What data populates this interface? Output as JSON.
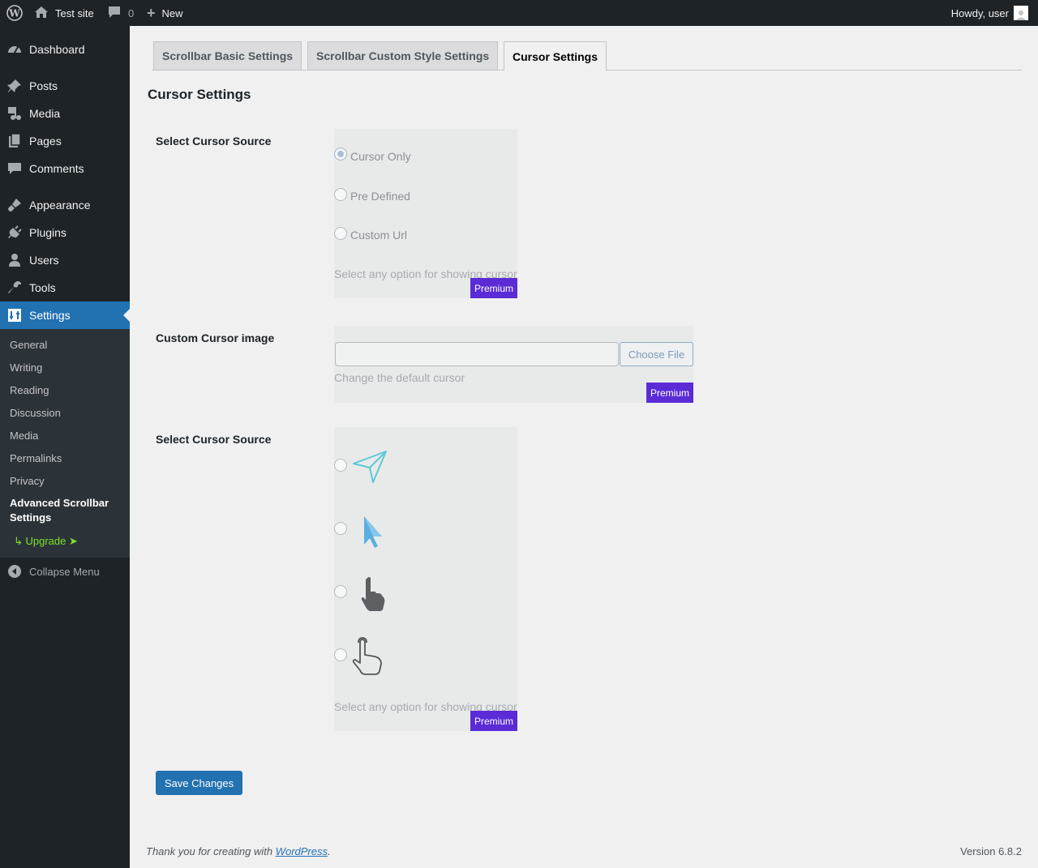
{
  "adminbar": {
    "site_name": "Test site",
    "comments_count": "0",
    "new_label": "New",
    "howdy": "Howdy, user"
  },
  "sidebar": {
    "items": [
      {
        "label": "Dashboard",
        "icon": "dashboard-icon"
      },
      {
        "label": "Posts",
        "icon": "pin-icon"
      },
      {
        "label": "Media",
        "icon": "media-icon"
      },
      {
        "label": "Pages",
        "icon": "pages-icon"
      },
      {
        "label": "Comments",
        "icon": "comment-icon"
      },
      {
        "label": "Appearance",
        "icon": "brush-icon"
      },
      {
        "label": "Plugins",
        "icon": "plug-icon"
      },
      {
        "label": "Users",
        "icon": "user-icon"
      },
      {
        "label": "Tools",
        "icon": "wrench-icon"
      },
      {
        "label": "Settings",
        "icon": "settings-icon"
      }
    ],
    "submenu": [
      "General",
      "Writing",
      "Reading",
      "Discussion",
      "Media",
      "Permalinks",
      "Privacy"
    ],
    "submenu_current": "Advanced Scrollbar Settings",
    "upgrade": "↳ Upgrade ➤",
    "collapse": "Collapse Menu"
  },
  "tabs": [
    "Scrollbar Basic Settings",
    "Scrollbar Custom Style Settings",
    "Cursor Settings"
  ],
  "heading": "Cursor Settings",
  "section1": {
    "label": "Select Cursor Source",
    "options": [
      "Cursor Only",
      "Pre Defined",
      "Custom Url"
    ],
    "selected": "Cursor Only",
    "description": "Select any option for showing cursor",
    "badge": "Premium"
  },
  "section2": {
    "label": "Custom Cursor image",
    "input_value": "",
    "button": "Choose File",
    "description": "Change the default cursor",
    "badge": "Premium"
  },
  "section3": {
    "label": "Select Cursor Source",
    "cursors": [
      "paper-plane-cursor-icon",
      "arrow-pointer-cursor-icon",
      "hand-pointer-cursor-icon",
      "outline-hand-cursor-icon"
    ],
    "description": "Select any option for showing cursor",
    "badge": "Premium"
  },
  "save_label": "Save Changes",
  "footer": {
    "thanks_prefix": "Thank you for creating with ",
    "thanks_link": "WordPress",
    "thanks_suffix": ".",
    "version": "Version 6.8.2"
  }
}
